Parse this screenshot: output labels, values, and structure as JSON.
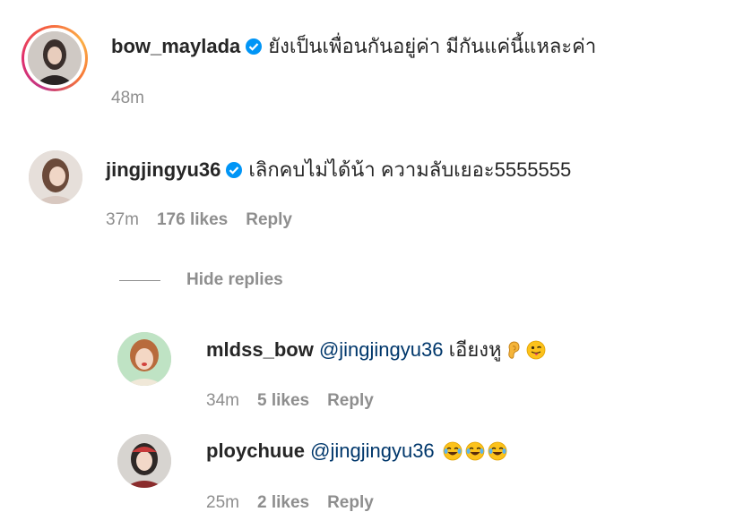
{
  "caption": {
    "username": "bow_maylada",
    "text": "ยังเป็นเพื่อนกันอยู่ค่า มีกันแค่นี้แหละค่า",
    "time": "48m"
  },
  "comments": [
    {
      "username": "jingjingyu36",
      "text": "เลิกคบไม่ได้น้า ความลับเยอะ5555555",
      "time": "37m",
      "likes": "176 likes",
      "reply_label": "Reply"
    }
  ],
  "hide_replies_label": "Hide replies",
  "replies": [
    {
      "username": "mldss_bow",
      "mention": "@jingjingyu36",
      "text": "เอียงหู",
      "emojis": [
        "ear-emoji",
        "winking-tongue-emoji"
      ],
      "time": "34m",
      "likes": "5 likes",
      "reply_label": "Reply"
    },
    {
      "username": "ploychuue",
      "mention": "@jingjingyu36",
      "text": "",
      "emojis": [
        "tears-of-joy-emoji",
        "tears-of-joy-emoji",
        "tears-of-joy-emoji"
      ],
      "time": "25m",
      "likes": "2 likes",
      "reply_label": "Reply"
    }
  ],
  "colors": {
    "verified_blue": "#0095f6",
    "mention_blue": "#00376b",
    "meta_gray": "#8e8e8e"
  }
}
